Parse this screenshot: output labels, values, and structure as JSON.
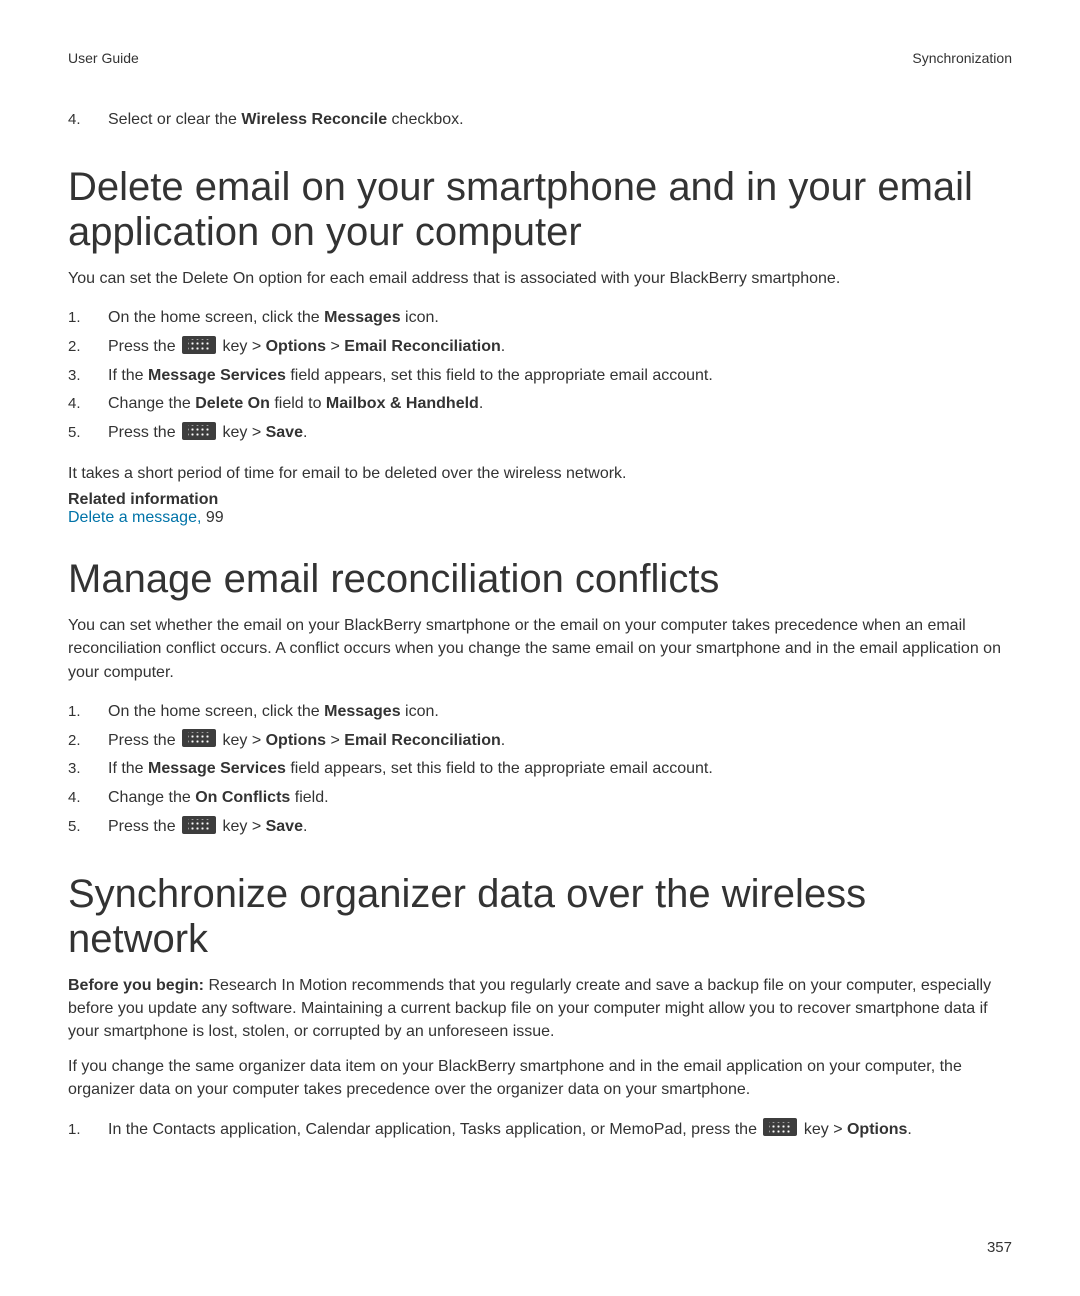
{
  "header": {
    "left": "User Guide",
    "right": "Synchronization"
  },
  "intro_step": {
    "number": "4.",
    "pre": "Select or clear the ",
    "bold": "Wireless Reconcile",
    "post": " checkbox."
  },
  "section1": {
    "heading": "Delete email on your smartphone and in your email application on your computer",
    "intro": "You can set the Delete On option for each email address that is associated with your BlackBerry smartphone.",
    "steps": {
      "s1": {
        "pre": "On the home screen, click the ",
        "b1": "Messages",
        "post": " icon."
      },
      "s2": {
        "pre": "Press the ",
        "mid": " key > ",
        "b1": "Options",
        "sep": " > ",
        "b2": "Email Reconciliation",
        "post": "."
      },
      "s3": {
        "pre": "If the ",
        "b1": "Message Services",
        "post": " field appears, set this field to the appropriate email account."
      },
      "s4": {
        "pre": "Change the ",
        "b1": "Delete On",
        "mid": " field to ",
        "b2": "Mailbox & Handheld",
        "post": "."
      },
      "s5": {
        "pre": "Press the ",
        "mid": " key > ",
        "b1": "Save",
        "post": "."
      }
    },
    "outro": "It takes a short period of time for email to be deleted over the wireless network.",
    "related_heading": "Related information",
    "related_link": "Delete a message,",
    "related_page": " 99"
  },
  "section2": {
    "heading": "Manage email reconciliation conflicts",
    "intro": "You can set whether the email on your BlackBerry smartphone or the email on your computer takes precedence when an email reconciliation conflict occurs. A conflict occurs when you change the same email on your smartphone and in the email application on your computer.",
    "steps": {
      "s1": {
        "pre": "On the home screen, click the ",
        "b1": "Messages",
        "post": " icon."
      },
      "s2": {
        "pre": "Press the ",
        "mid": " key > ",
        "b1": "Options",
        "sep": " > ",
        "b2": "Email Reconciliation",
        "post": "."
      },
      "s3": {
        "pre": "If the ",
        "b1": "Message Services",
        "post": " field appears, set this field to the appropriate email account."
      },
      "s4": {
        "pre": "Change the ",
        "b1": "On Conflicts",
        "post": " field."
      },
      "s5": {
        "pre": "Press the ",
        "mid": " key > ",
        "b1": "Save",
        "post": "."
      }
    }
  },
  "section3": {
    "heading": "Synchronize organizer data over the wireless network",
    "p1": {
      "b1": "Before you begin:",
      "text": " Research In Motion recommends that you regularly create and save a backup file on your computer, especially before you update any software. Maintaining a current backup file on your computer might allow you to recover smartphone data if your smartphone is lost, stolen, or corrupted by an unforeseen issue."
    },
    "p2": "If you change the same organizer data item on your BlackBerry smartphone and in the email application on your computer, the organizer data on your computer takes precedence over the organizer data on your smartphone.",
    "steps": {
      "s1": {
        "pre": "In the Contacts application, Calendar application, Tasks application, or MemoPad, press the ",
        "mid": " key > ",
        "b1": "Options",
        "post": "."
      }
    }
  },
  "page_number": "357"
}
